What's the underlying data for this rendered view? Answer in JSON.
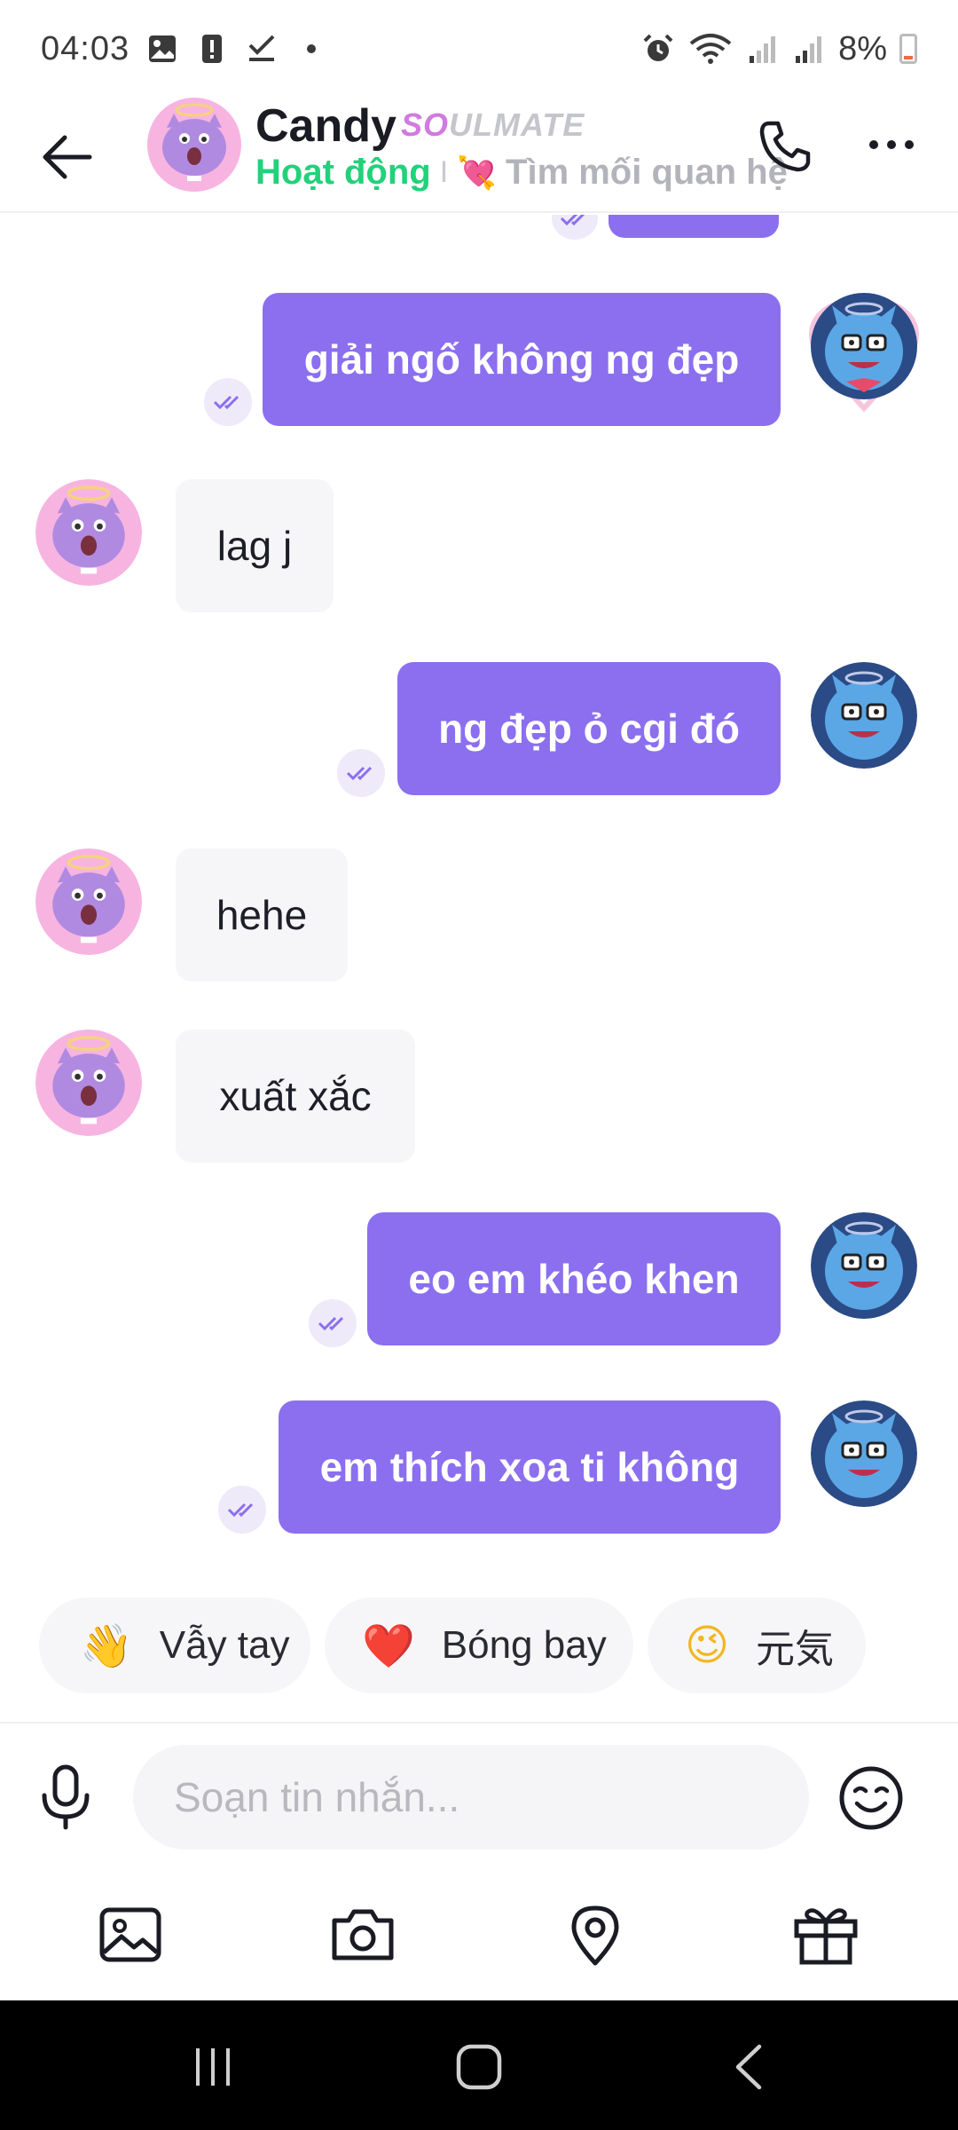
{
  "status_bar": {
    "time": "04:03",
    "battery": "8%",
    "icons": [
      "gallery-icon",
      "alert-icon",
      "check-icon",
      "dot-icon",
      "alarm-icon",
      "wifi-icon",
      "signal-icon",
      "signal-icon",
      "battery-icon"
    ]
  },
  "header": {
    "name": "Candy",
    "badge_so": "SO",
    "badge_rest": "ULMATE",
    "status_active": "Hoạt động",
    "status_separator": "I",
    "status_emoji": "💘",
    "status_goal": "Tìm mối quan hệ"
  },
  "messages": [
    {
      "side": "out",
      "text": "giải ngố không ng đẹp"
    },
    {
      "side": "in",
      "text": "lag j"
    },
    {
      "side": "out",
      "text": "ng đẹp ỏ cgi đó"
    },
    {
      "side": "in",
      "text": "hehe"
    },
    {
      "side": "in",
      "text": "xuất xắc"
    },
    {
      "side": "out",
      "text": "eo em khéo khen"
    },
    {
      "side": "out",
      "text": "em thích xoa ti không"
    }
  ],
  "quick_replies": [
    {
      "emoji": "👋",
      "label": "Vẫy tay"
    },
    {
      "emoji": "❤️",
      "label": "Bóng bay"
    },
    {
      "emoji": "😉",
      "label": "元気"
    }
  ],
  "composer": {
    "placeholder": "Soạn tin nhắn..."
  },
  "colors": {
    "accent": "#8b6fef",
    "active_green": "#22d17a",
    "incoming_bubble": "#f6f6f8"
  }
}
